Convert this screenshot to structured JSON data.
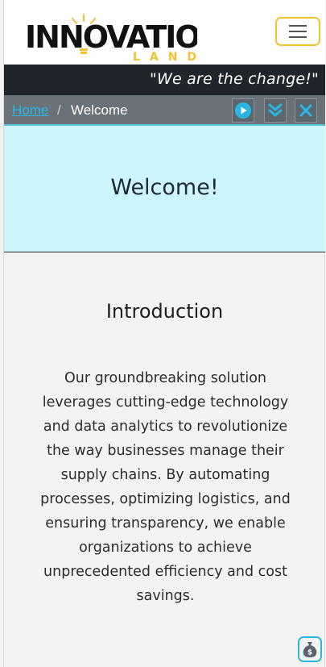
{
  "header": {
    "logo_text_main": "INNOVATION",
    "logo_text_sub": "LAND",
    "menu_icon": "hamburger-icon"
  },
  "tagline": "\"We are the change!\"",
  "breadcrumb": {
    "home": "Home",
    "separator": "/",
    "current": "Welcome",
    "controls": [
      "play-icon",
      "double-chevron-down-icon",
      "close-icon"
    ]
  },
  "hero": {
    "title": "Welcome!"
  },
  "intro": {
    "heading": "Introduction",
    "body": "Our groundbreaking solution leverages cutting-edge technology and data analytics to revolutionize the way businesses manage their supply chains. By automating processes, optimizing logistics, and ensuring transparency, we enable organizations to achieve unprecedented efficiency and cost savings."
  },
  "floating_button_icon": "money-bag-icon",
  "colors": {
    "accent_yellow": "#f2c230",
    "accent_cyan": "#2bb7d8",
    "hero_bg": "#cdf5fc",
    "dark_bar": "#20242b"
  }
}
